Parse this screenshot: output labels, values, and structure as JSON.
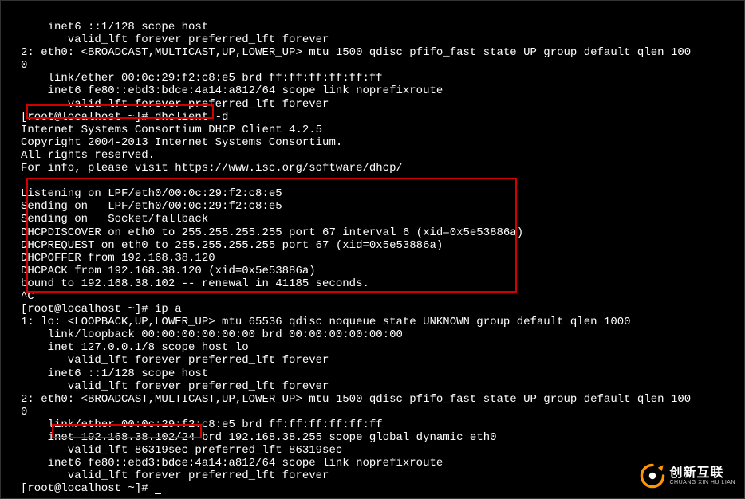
{
  "terminal": {
    "lines": [
      "    inet6 ::1/128 scope host",
      "       valid_lft forever preferred_lft forever",
      "2: eth0: <BROADCAST,MULTICAST,UP,LOWER_UP> mtu 1500 qdisc pfifo_fast state UP group default qlen 100",
      "0",
      "    link/ether 00:0c:29:f2:c8:e5 brd ff:ff:ff:ff:ff:ff",
      "    inet6 fe80::ebd3:bdce:4a14:a812/64 scope link noprefixroute",
      "       valid_lft forever preferred_lft forever",
      "[root@localhost ~]# dhclient -d",
      "Internet Systems Consortium DHCP Client 4.2.5",
      "Copyright 2004-2013 Internet Systems Consortium.",
      "All rights reserved.",
      "For info, please visit https://www.isc.org/software/dhcp/",
      "",
      "Listening on LPF/eth0/00:0c:29:f2:c8:e5",
      "Sending on   LPF/eth0/00:0c:29:f2:c8:e5",
      "Sending on   Socket/fallback",
      "DHCPDISCOVER on eth0 to 255.255.255.255 port 67 interval 6 (xid=0x5e53886a)",
      "DHCPREQUEST on eth0 to 255.255.255.255 port 67 (xid=0x5e53886a)",
      "DHCPOFFER from 192.168.38.120",
      "DHCPACK from 192.168.38.120 (xid=0x5e53886a)",
      "bound to 192.168.38.102 -- renewal in 41185 seconds.",
      "^C",
      "[root@localhost ~]# ip a",
      "1: lo: <LOOPBACK,UP,LOWER_UP> mtu 65536 qdisc noqueue state UNKNOWN group default qlen 1000",
      "    link/loopback 00:00:00:00:00:00 brd 00:00:00:00:00:00",
      "    inet 127.0.0.1/8 scope host lo",
      "       valid_lft forever preferred_lft forever",
      "    inet6 ::1/128 scope host",
      "       valid_lft forever preferred_lft forever",
      "2: eth0: <BROADCAST,MULTICAST,UP,LOWER_UP> mtu 1500 qdisc pfifo_fast state UP group default qlen 100",
      "0",
      "    link/ether 00:0c:29:f2:c8:e5 brd ff:ff:ff:ff:ff:ff",
      "    inet 192.168.38.102/24 brd 192.168.38.255 scope global dynamic eth0",
      "       valid_lft 86319sec preferred_lft 86319sec",
      "    inet6 fe80::ebd3:bdce:4a14:a812/64 scope link noprefixroute",
      "       valid_lft forever preferred_lft forever",
      "[root@localhost ~]# "
    ]
  },
  "logo": {
    "cn": "创新互联",
    "en": "CHUANG XIN HU LIAN"
  }
}
